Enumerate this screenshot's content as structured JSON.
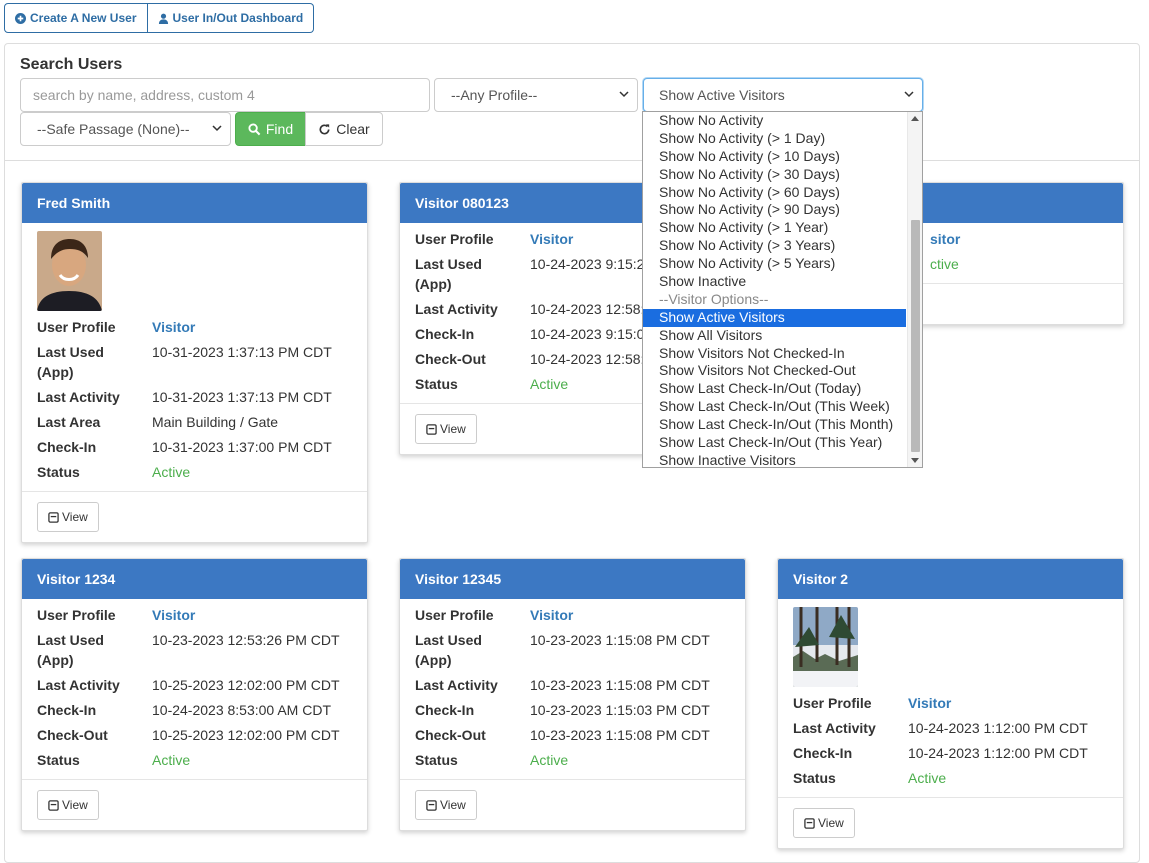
{
  "top_buttons": {
    "create_user": "Create A New User",
    "dashboard": "User In/Out Dashboard"
  },
  "search": {
    "title": "Search Users",
    "placeholder": "search by name, address, custom 4",
    "profile_select": "--Any Profile--",
    "status_select": "Show Active Visitors",
    "safe_passage_select": "--Safe Passage (None)--",
    "find_label": "Find",
    "clear_label": "Clear"
  },
  "status_options": [
    "Show No Activity",
    "Show No Activity (> 1 Day)",
    "Show No Activity (> 10 Days)",
    "Show No Activity (> 30 Days)",
    "Show No Activity (> 60 Days)",
    "Show No Activity (> 90 Days)",
    "Show No Activity (> 1 Year)",
    "Show No Activity (> 3 Years)",
    "Show No Activity (> 5 Years)",
    "Show Inactive",
    "--Visitor Options--",
    "Show Active Visitors",
    "Show All Visitors",
    "Show Visitors Not Checked-In",
    "Show Visitors Not Checked-Out",
    "Show Last Check-In/Out (Today)",
    "Show Last Check-In/Out (This Week)",
    "Show Last Check-In/Out (This Month)",
    "Show Last Check-In/Out (This Year)",
    "Show Inactive Visitors"
  ],
  "view_label": "View",
  "labels": {
    "profile": "User Profile",
    "last_used_1": "Last Used",
    "last_used_2": "(App)",
    "last_activity": "Last Activity",
    "last_area": "Last Area",
    "checkin": "Check-In",
    "checkout": "Check-Out",
    "status": "Status"
  },
  "cards": [
    {
      "name": "Fred Smith",
      "profile": "Visitor",
      "last_used": "10-31-2023 1:37:13 PM CDT",
      "last_activity": "10-31-2023 1:37:13 PM CDT",
      "last_area": "Main Building / Gate",
      "checkin": "10-31-2023 1:37:00 PM CDT",
      "status": "Active"
    },
    {
      "name": "Visitor 080123",
      "profile": "Visitor",
      "last_used": "10-24-2023 9:15:2",
      "last_activity": "10-24-2023 12:58:",
      "checkin": "10-24-2023 9:15:0",
      "checkout": "10-24-2023 12:58:",
      "status": "Active"
    },
    {
      "profile": "sitor",
      "status": "ctive"
    },
    {
      "name": "Visitor 1234",
      "profile": "Visitor",
      "last_used": "10-23-2023 12:53:26 PM CDT",
      "last_activity": "10-25-2023 12:02:00 PM CDT",
      "checkin": "10-24-2023 8:53:00 AM CDT",
      "checkout": "10-25-2023 12:02:00 PM CDT",
      "status": "Active"
    },
    {
      "name": "Visitor 12345",
      "profile": "Visitor",
      "last_used": "10-23-2023 1:15:08 PM CDT",
      "last_activity": "10-23-2023 1:15:08 PM CDT",
      "checkin": "10-23-2023 1:15:03 PM CDT",
      "checkout": "10-23-2023 1:15:08 PM CDT",
      "status": "Active"
    },
    {
      "name": "Visitor 2",
      "profile": "Visitor",
      "last_activity": "10-24-2023 1:12:00 PM CDT",
      "checkin": "10-24-2023 1:12:00 PM CDT",
      "status": "Active"
    }
  ]
}
